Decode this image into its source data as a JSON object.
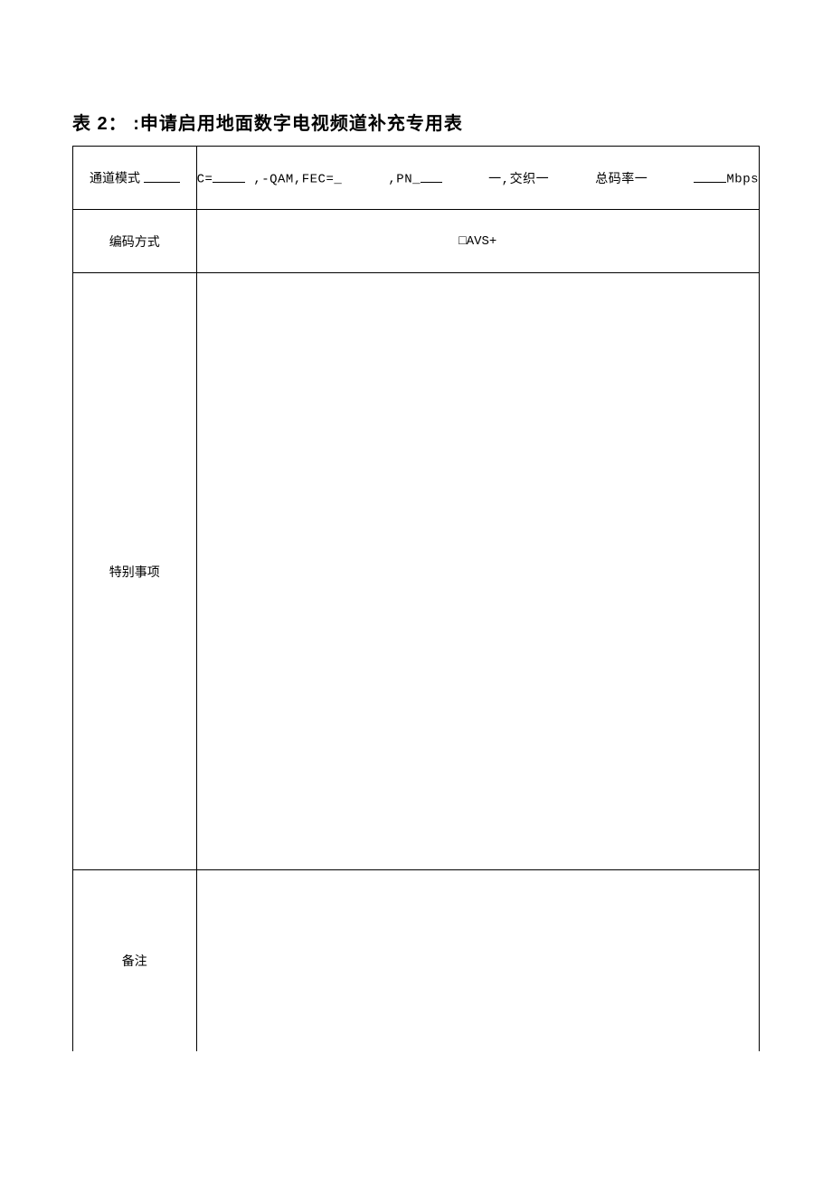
{
  "title": "表 2： :申请启用地面数字电视频道补充专用表",
  "row1": {
    "label": "通道模式",
    "c_prefix": "C=",
    "qam_fec": ",-QAM,FEC=_",
    "pn": ",PN_",
    "jiaozhi_prefix": "一,交织一",
    "rate_label": "总码率一",
    "unit": "Mbps"
  },
  "row2": {
    "label": "编码方式",
    "value": "□AVS+"
  },
  "row3": {
    "label": "特别事项",
    "value": ""
  },
  "row4": {
    "label": "备注",
    "value": ""
  }
}
